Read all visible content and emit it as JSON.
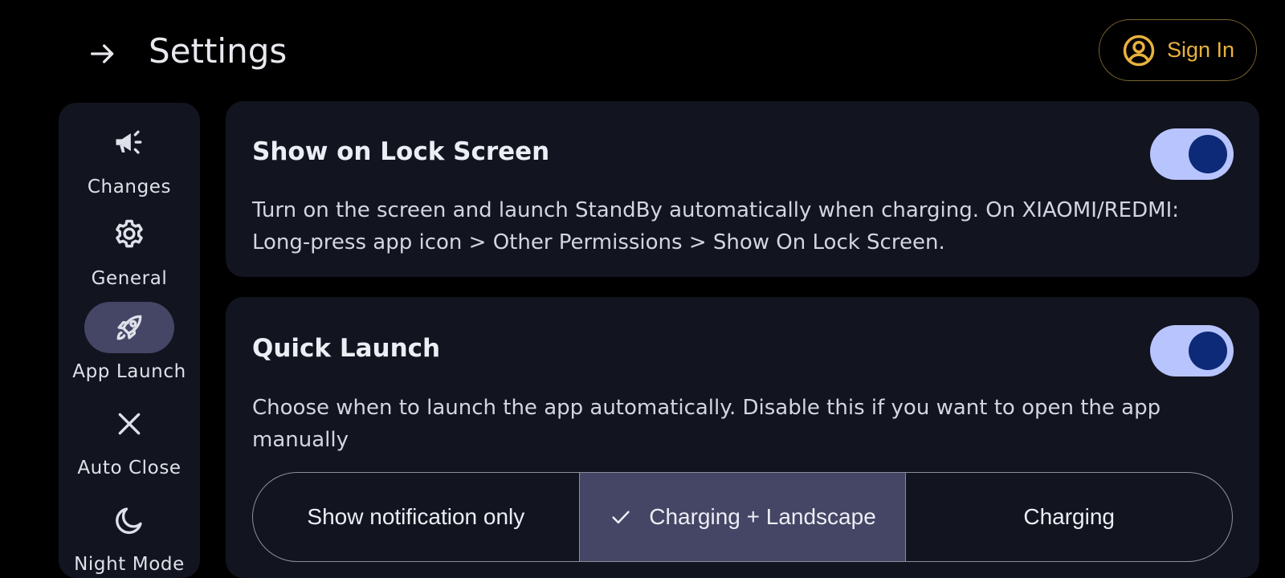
{
  "header": {
    "back_icon": "arrow-right-icon",
    "title": "Settings",
    "signin_icon": "account-circle-icon",
    "signin_label": "Sign In",
    "accent_color": "#e8b23e"
  },
  "nav": {
    "items": [
      {
        "label": "Changes",
        "icon": "megaphone-icon",
        "active": false
      },
      {
        "label": "General",
        "icon": "gear-icon",
        "active": false
      },
      {
        "label": "App Launch",
        "icon": "rocket-icon",
        "active": true
      },
      {
        "label": "Auto Close",
        "icon": "close-icon",
        "active": false
      },
      {
        "label": "Night Mode",
        "icon": "moon-icon",
        "active": false
      }
    ],
    "active_bg": "#454565"
  },
  "cards": {
    "lock_screen": {
      "title": "Show on Lock Screen",
      "description": "Turn on the screen and launch StandBy automatically when charging. On XIAOMI/REDMI: Long-press app icon > Other Permissions > Show On Lock Screen.",
      "toggle_on": true
    },
    "quick_launch": {
      "title": "Quick Launch",
      "description": "Choose when to launch the app automatically. Disable this if you want to open the app manually",
      "toggle_on": true,
      "options": [
        {
          "label": "Show notification only",
          "selected": false
        },
        {
          "label": "Charging + Landscape",
          "selected": true
        },
        {
          "label": "Charging",
          "selected": false
        }
      ]
    }
  },
  "colors": {
    "background": "#000000",
    "surface": "#121420",
    "toggle_track": "#b8c4fe",
    "toggle_knob": "#0d2a78"
  }
}
